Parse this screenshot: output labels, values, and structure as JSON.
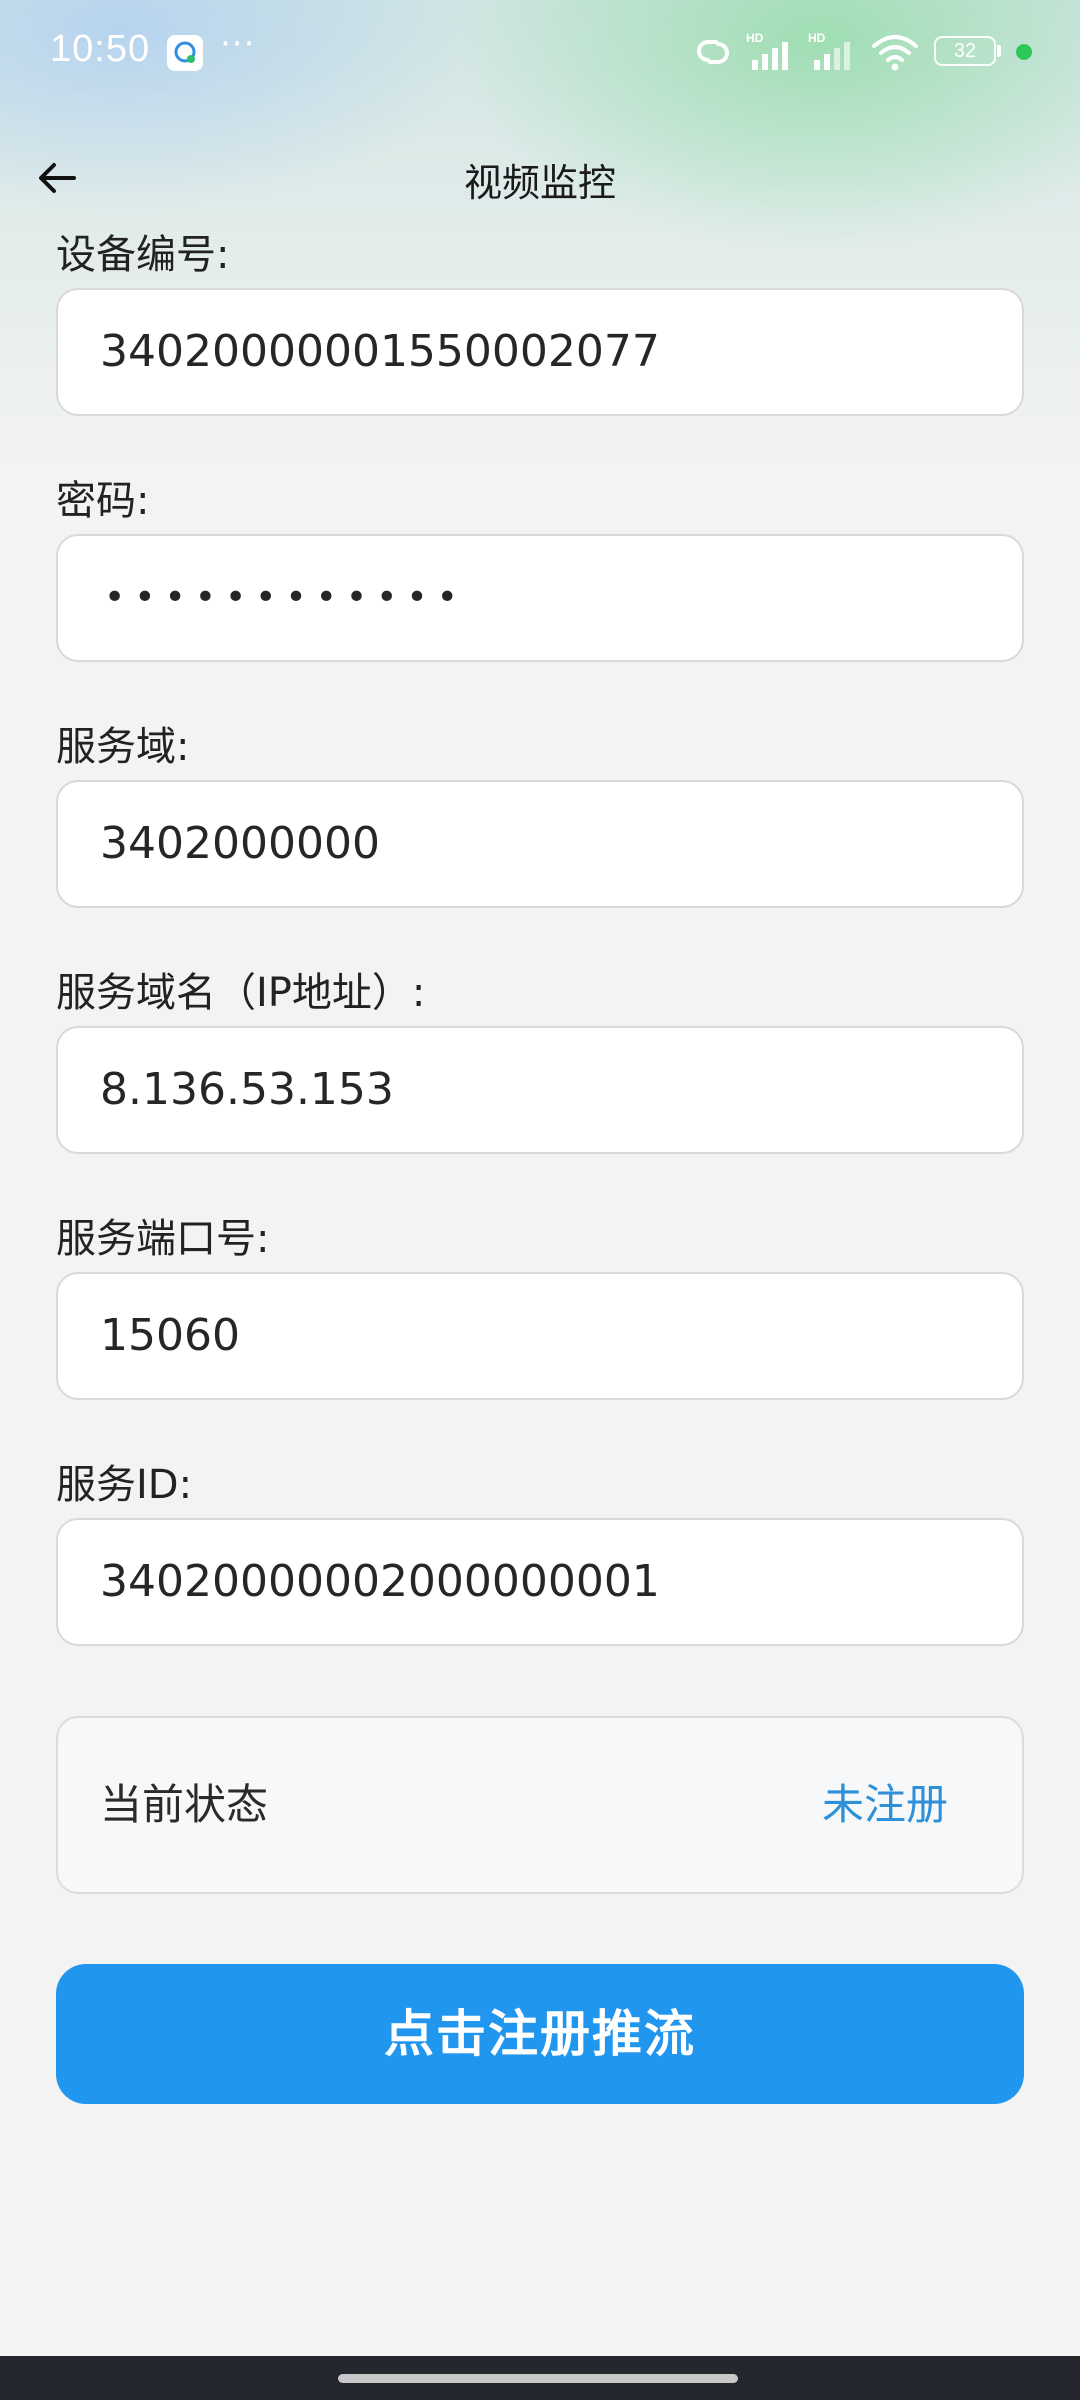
{
  "status_bar": {
    "time": "10:50",
    "more": "···",
    "battery_level": "32",
    "icons": [
      "app-notification-icon",
      "hotspot-link-icon",
      "hd-signal-icon",
      "hd-signal-icon",
      "wifi-icon",
      "battery-icon",
      "green-dot-indicator"
    ],
    "colors": {
      "text": "#ffffff",
      "green_dot": "#2ec85a"
    }
  },
  "header": {
    "back_icon": "arrow-left-icon",
    "title": "视频监控"
  },
  "form": {
    "device_id": {
      "label": "设备编号:",
      "value": "34020000001550002077"
    },
    "password": {
      "label": "密码:",
      "value": "••••••••••••"
    },
    "service_domain": {
      "label": "服务域:",
      "value": "3402000000"
    },
    "service_host": {
      "label": "服务域名（IP地址）:",
      "value": "8.136.53.153"
    },
    "service_port": {
      "label": "服务端口号:",
      "value": "15060"
    },
    "service_id": {
      "label": "服务ID:",
      "value": "34020000002000000001"
    }
  },
  "status": {
    "label": "当前状态",
    "value": "未注册",
    "value_color": "#2e90d8"
  },
  "actions": {
    "register_label": "点击注册推流",
    "button_color": "#2196ee"
  }
}
